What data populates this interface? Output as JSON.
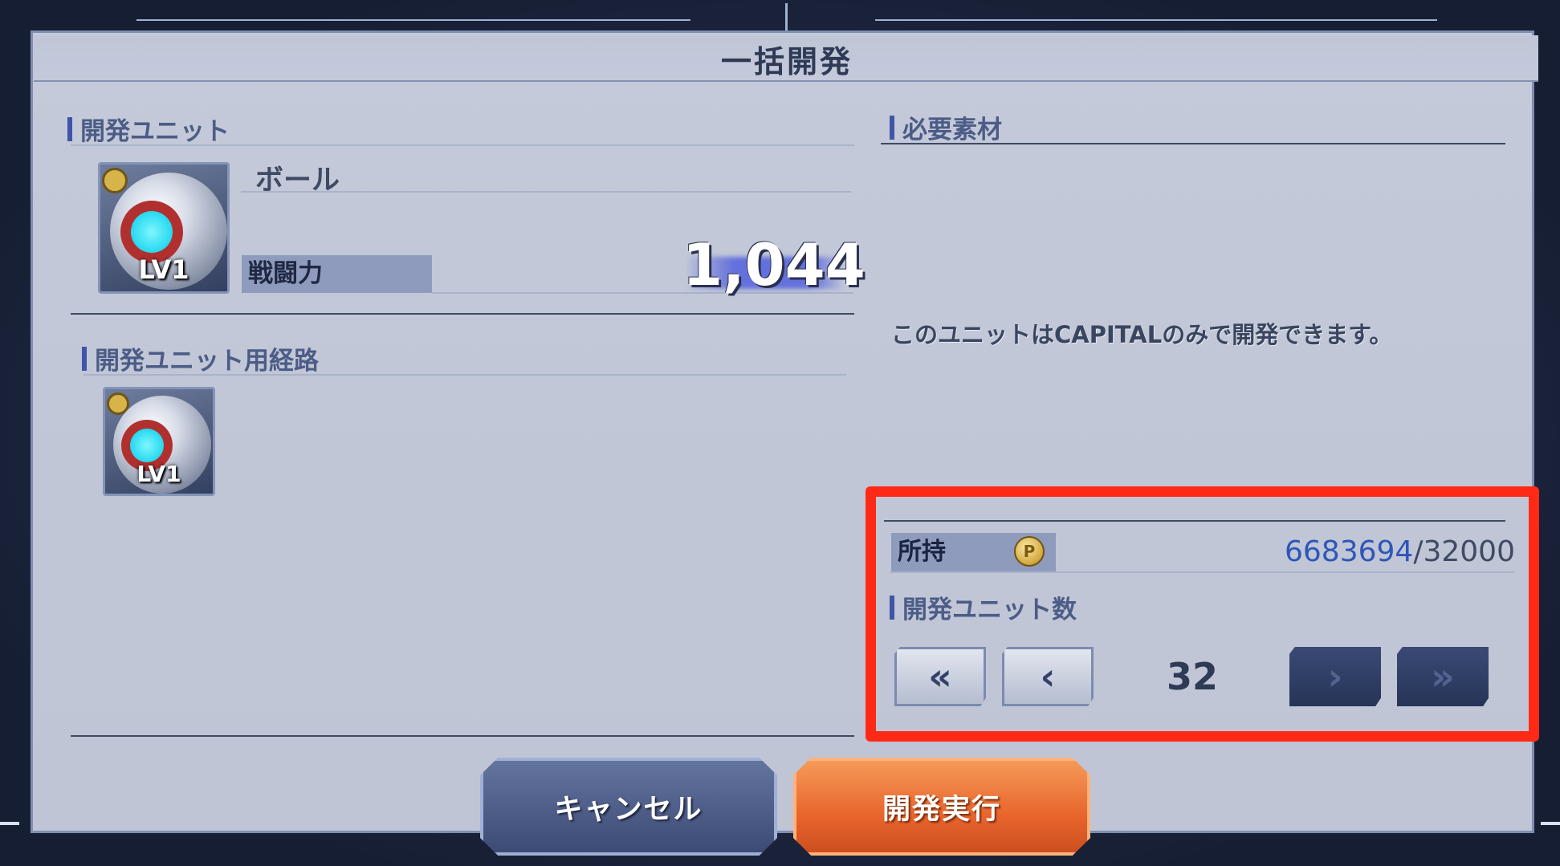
{
  "dialog": {
    "title": "一括開発"
  },
  "dev_unit": {
    "section_label": "開発ユニット",
    "unit_name": "ボール",
    "level_label": "LV1",
    "power_label": "戦闘力",
    "power_value": "1,044"
  },
  "dev_route": {
    "section_label": "開発ユニット用経路",
    "level_label": "LV1"
  },
  "materials": {
    "section_label": "必要素材",
    "note": "このユニットはCAPITALのみで開発できます。"
  },
  "owned": {
    "label": "所持",
    "coin_symbol": "P",
    "have": "6683694",
    "separator": "/32000"
  },
  "unit_count": {
    "section_label": "開発ユニット数",
    "value": "32",
    "btn_min": "«",
    "btn_dec": "‹",
    "btn_inc": "›",
    "btn_max": "»"
  },
  "buttons": {
    "cancel": "キャンセル",
    "execute": "開発実行"
  },
  "colors": {
    "highlight": "#ff2a16",
    "accent_blue": "#3e56a8",
    "execute_orange": "#e8652c"
  }
}
